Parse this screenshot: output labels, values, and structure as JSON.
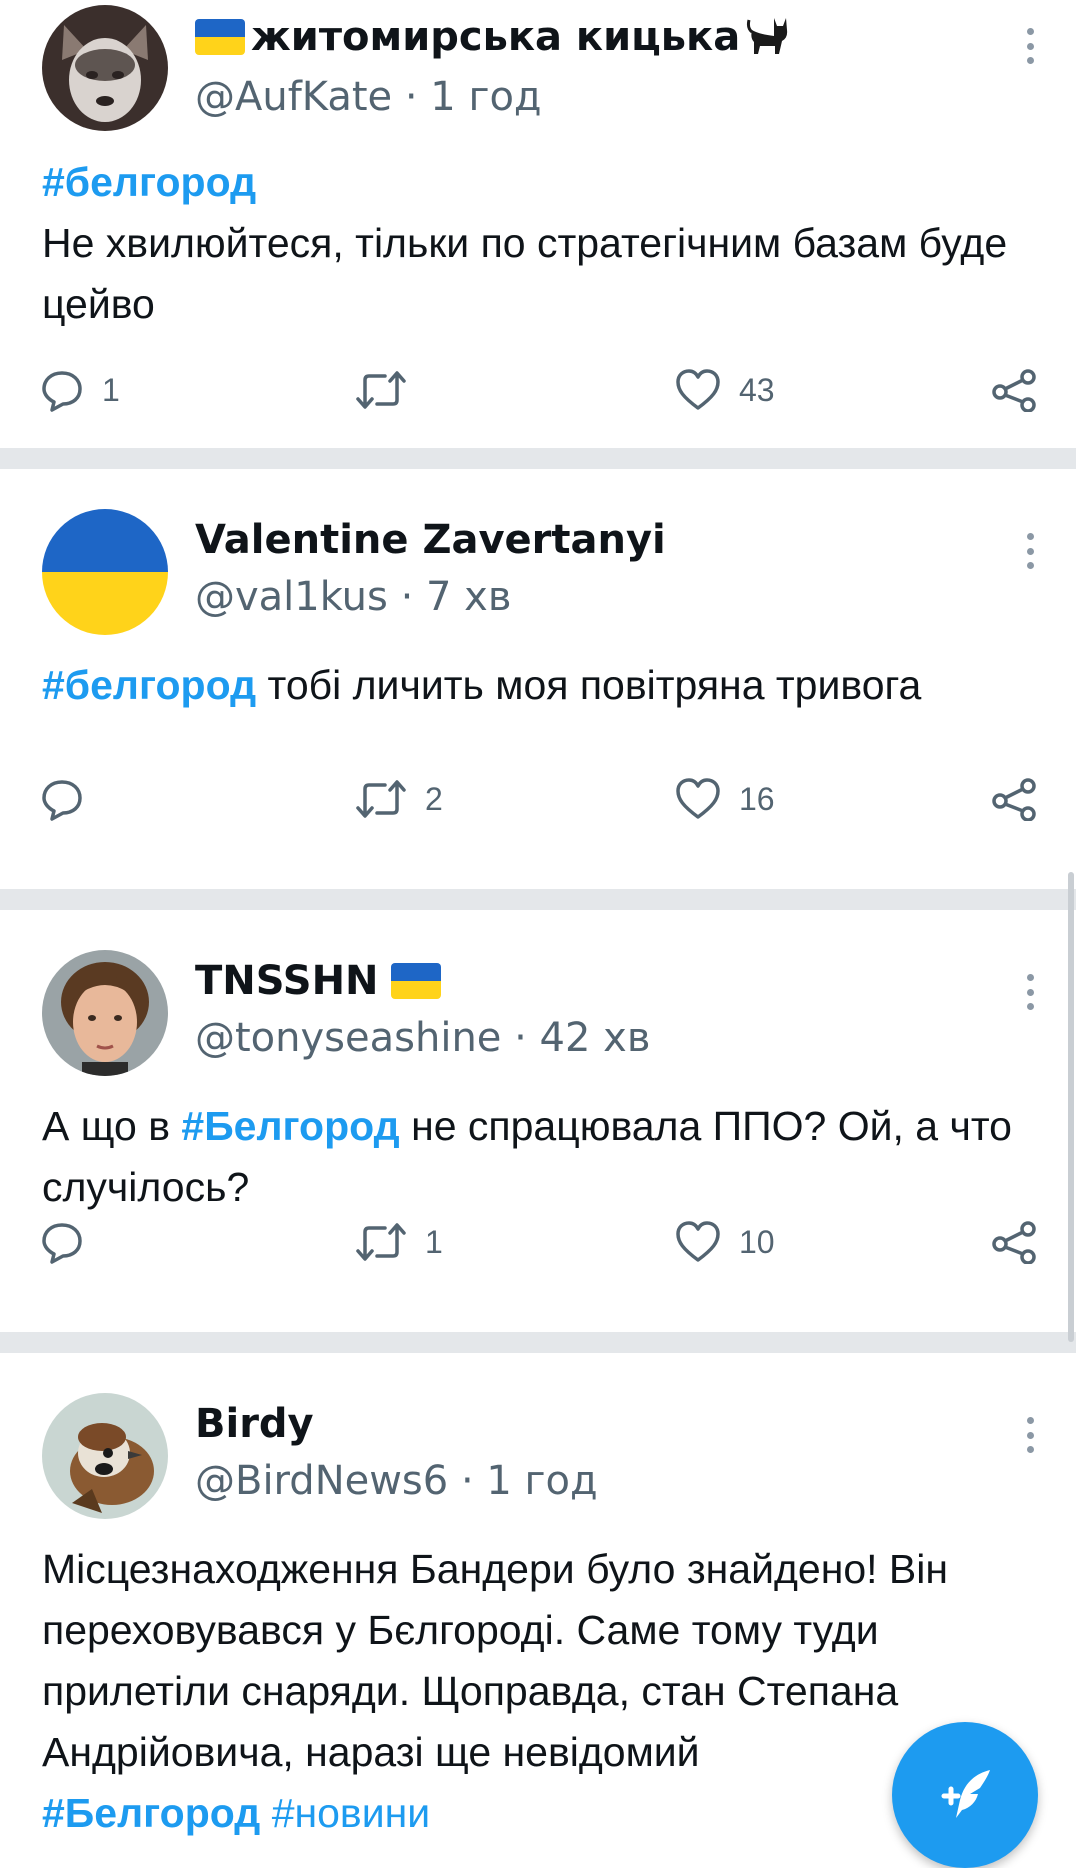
{
  "tweets": [
    {
      "name": "житомирська кицька",
      "handle": "@AufKate · 1 год",
      "text_parts": [
        "#белгород",
        "Не хвилюйтеся, тільки по стратегічним базам буде цейво"
      ],
      "counts": {
        "reply": "1",
        "retweet": "",
        "like": "43"
      }
    },
    {
      "name": "Valentine Zavertanyi",
      "handle": "@val1kus · 7 хв",
      "text_parts": [
        "#белгород",
        " тобі личить моя повітряна тривога"
      ],
      "counts": {
        "reply": "",
        "retweet": "2",
        "like": "16"
      }
    },
    {
      "name": "TNSSHN",
      "handle": "@tonyseashine · 42 хв",
      "text_parts": [
        "А що в ",
        "#Белгород",
        " не спрацювала ППО? Ой, а что случілось?"
      ],
      "counts": {
        "reply": "",
        "retweet": "1",
        "like": "10"
      }
    },
    {
      "name": "Birdy",
      "handle": "@BirdNews6 · 1 год",
      "text_parts": [
        "Місцезнаходження Бандери було знайдено! Він переховувався у Бєлгороді. Саме тому туди прилетіли снаряди. Щоправда, стан Степана Андрійовича, наразі ще невідомий",
        "#Белгород",
        " ",
        "#новини"
      ]
    }
  ],
  "colors": {
    "accent": "#1d9bf0",
    "muted": "#536471",
    "separator": "#e4e7ea"
  },
  "icons": [
    "ukraine-flag-icon",
    "cat-icon",
    "more-vertical-icon",
    "reply-icon",
    "retweet-icon",
    "like-icon",
    "share-icon",
    "compose-tweet-icon"
  ]
}
